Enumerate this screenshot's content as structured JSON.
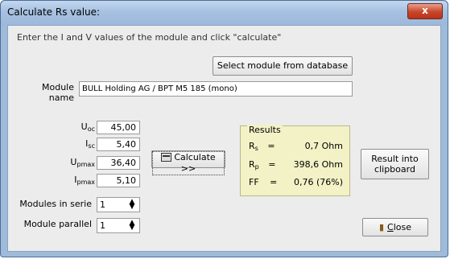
{
  "window": {
    "title": "Calculate Rs value:",
    "close_glyph": "x"
  },
  "instruction": "Enter the I and V values of the module and click \"calculate\"",
  "select_button": "Select module from database",
  "module": {
    "label_line1": "Module",
    "label_line2": "name",
    "value": "BULL Holding AG / BPT M5 185 (mono)"
  },
  "params": {
    "uoc": {
      "main": "U",
      "sub": "oc",
      "value": "45,00"
    },
    "isc": {
      "main": "I",
      "sub": "sc",
      "value": "5,40"
    },
    "upmax": {
      "main": "U",
      "sub": "pmax",
      "value": "36,40"
    },
    "ipmax": {
      "main": "I",
      "sub": "pmax",
      "value": "5,10"
    }
  },
  "calculate_button": "Calculate >>",
  "results": {
    "title": "Results",
    "rs": {
      "main": "R",
      "sub": "s",
      "eq": "=",
      "value": "0,7 Ohm"
    },
    "rp": {
      "main": "R",
      "sub": "p",
      "eq": "=",
      "value": "398,6 Ohm"
    },
    "ff": {
      "main": "FF",
      "eq": "=",
      "value": "0,76 (76%)"
    }
  },
  "clipboard_button_line1": "Result into",
  "clipboard_button_line2": "clipboard",
  "modules_in_serie": {
    "label": "Modules in serie",
    "value": "1"
  },
  "module_parallel": {
    "label": "Module parallel",
    "value": "1"
  },
  "close_button": {
    "underlined": "C",
    "rest": "lose"
  }
}
